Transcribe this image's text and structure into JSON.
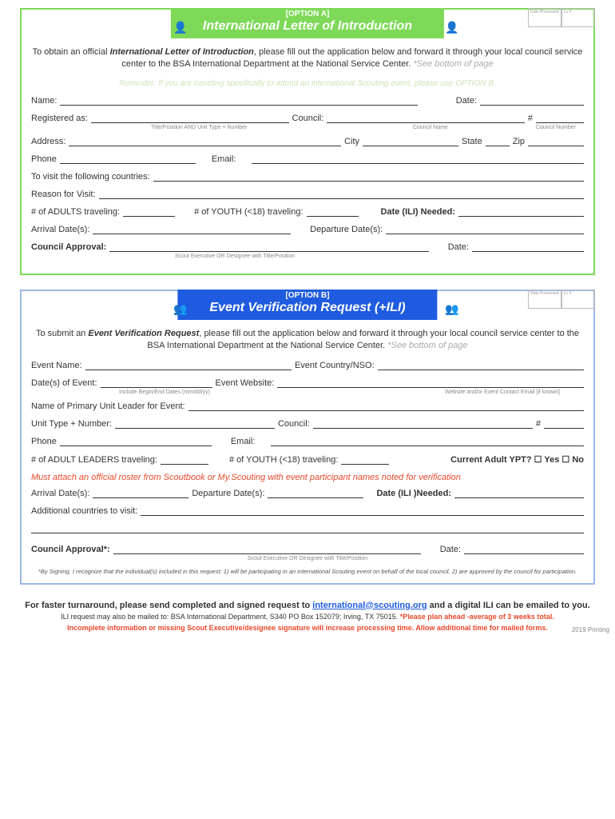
{
  "optA": {
    "tag": "[OPTION A]",
    "title": "International Letter of Introduction",
    "box1": "Date Processed",
    "box2": "Lc #",
    "intro1": "To obtain an official ",
    "intro2": "International Letter of Introduction",
    "intro3": ", please fill out the application below and forward it through your local council service center to the BSA International Department at the National Service Center. ",
    "intro4": "*See bottom of page",
    "reminder": "Reminder: If you are traveling specifically to attend an international Scouting event, please use OPTION B.",
    "name": "Name:",
    "date": "Date:",
    "reg": "Registered    as:",
    "council": "Council:",
    "hash": "#",
    "sub_reg": "Title/Position AND Unit Type + Number",
    "sub_council": "Council Name",
    "sub_num": "Council Number",
    "address": "Address:",
    "city": "City",
    "state": "State",
    "zip": "Zip",
    "phone": "Phone",
    "email": "Email:",
    "visit": "To visit the following countries:",
    "reason": "Reason for Visit:",
    "adults": "# of ADULTS traveling:",
    "youth": "# of YOUTH (<18) traveling:",
    "needed": "Date (ILI) Needed:",
    "arrival": "Arrival Date(s):",
    "departure": "Departure Date(s):",
    "approval": "Council  Approval:",
    "date2": "Date:",
    "sub_approval": "Scout Executive OR Designee with Title/Position"
  },
  "optB": {
    "tag": "[OPTION B]",
    "title": "Event Verification Request (+ILI)",
    "box1": "Date Processed",
    "box2": "Lc #",
    "intro1": "To submit an ",
    "intro2": "Event Verification Request",
    "intro3": ", please fill out the application below and forward it through your local council service center to the BSA International Department at the National Service Center. ",
    "intro4": "*See bottom of page",
    "ev_name": "Event Name:",
    "ev_country": "Event Country/NSO:",
    "ev_dates": "Date(s) of Event:",
    "ev_site": "Event Website:",
    "sub_dates": "Include Begin/End Dates (mm/dd/yy)",
    "sub_site": "Website and/or Event Contact Email [if known]",
    "leader": "Name of Primary Unit Leader for Event:",
    "unit": "Unit Type + Number:",
    "council": "Council:",
    "hash": "#",
    "phone": "Phone",
    "email": "Email:",
    "adults": "# of ADULT LEADERS traveling:",
    "youth": "# of YOUTH (<18) traveling:",
    "ypt": "Current Adult YPT?  ☐ Yes  ☐ No",
    "warn": "Must attach an official roster from Scoutbook or My.Scouting with event participant names noted for verification",
    "arrival": "Arrival Date(s):",
    "departure": "Departure Date(s):",
    "needed": "Date (ILI )Needed:",
    "addl": "Additional  countries to visit:",
    "approval": "Council  Approval*:",
    "date": "Date:",
    "sub_approval": "Scout Executive OR Designee with Title/Position",
    "signing": "*By Signing, I recognize that the individual(s) included in this request: 1) will be participating in an international Scouting event on behalf of the local council.  2) are approved by the council for participation."
  },
  "footer": {
    "line1a": "For faster turnaround, please send completed and ",
    "line1b": "signed",
    "line1c": " request to ",
    "email": "international@scouting.org",
    "line1d": " and a digital ILI can be emailed to you.",
    "line2a": "ILI request may also be mailed to: BSA International Department, S340 PO Box 152079; Irving, TX 75015.  ",
    "line2b": "*Please plan ahead -average of 3 weeks total.",
    "line3": "Incomplete information or missing Scout Executive/designee signature will increase processing time. Allow additional time for mailed forms.",
    "print": "2019 Printing"
  }
}
